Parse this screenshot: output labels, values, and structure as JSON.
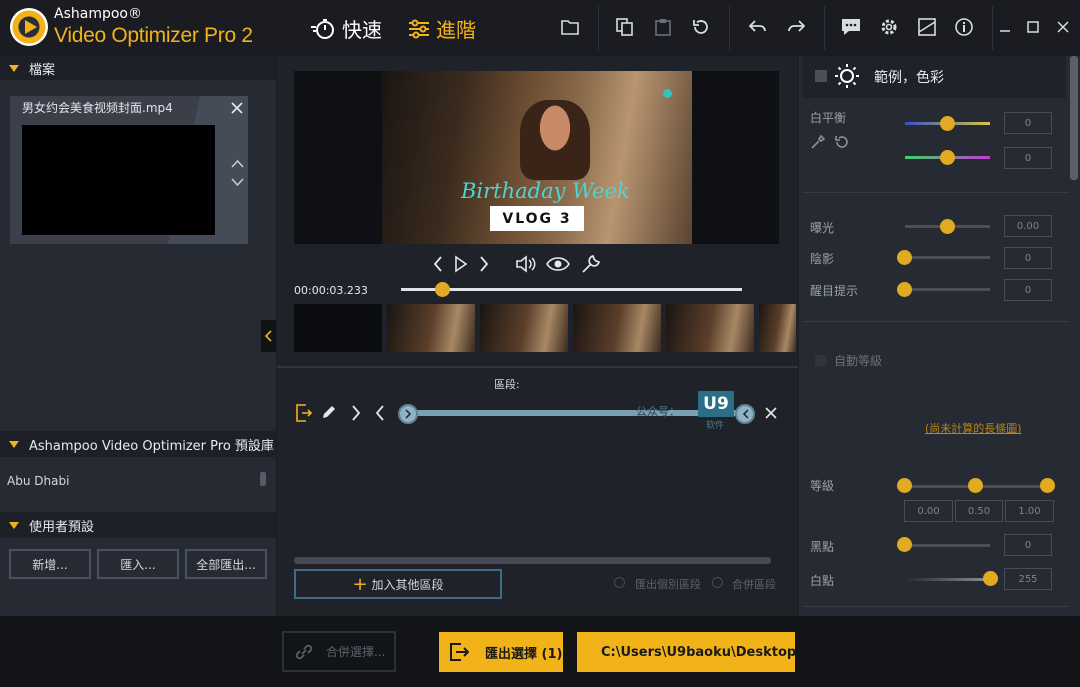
{
  "app": {
    "brand_line1": "Ashampoo®",
    "brand_line2": "Video Optimizer Pro 2",
    "mode_quick": "快速",
    "mode_advanced": "進階",
    "accent": "#f2b318"
  },
  "left": {
    "files_header": "檔案",
    "file_name": "男女约会美食视频封面.mp4",
    "presets_header": "Ashampoo Video Optimizer Pro 預設庫",
    "preset_item": "Abu Dhabi",
    "user_presets_header": "使用者預設",
    "btn_new": "新增...",
    "btn_import": "匯入...",
    "btn_export_all": "全部匯出..."
  },
  "center": {
    "overlay_script": "Birthaday Week",
    "overlay_vlog": "VLOG 3",
    "timecode": "00:00:03.233",
    "playhead_fraction": 0.12,
    "segments_label": "區段:",
    "add_segment": "加入其他區段",
    "export_individual": "匯出個別區段",
    "merge_segments": "合併區段",
    "watermark_text": "公众号：",
    "watermark_logo": "U9",
    "watermark_sub": "软件"
  },
  "right": {
    "section_title": "範例，色彩",
    "white_balance": "白平衡",
    "wb1_value": "0",
    "wb2_value": "0",
    "exposure": "曝光",
    "exposure_value": "0.00",
    "shadows": "陰影",
    "shadows_value": "0",
    "highlights": "醒目提示",
    "highlights_value": "0",
    "auto_levels": "自動等級",
    "histogram_link": "(尚未計算的長條圖)",
    "levels": "等級",
    "levels_v1": "0.00",
    "levels_v2": "0.50",
    "levels_v3": "1.00",
    "black_point": "黑點",
    "black_value": "0",
    "white_point": "白點",
    "white_value": "255"
  },
  "bottom": {
    "merge_selection": "合併選擇...",
    "export_selection": "匯出選擇 (1)",
    "output_path": "C:\\Users\\U9baoku\\Desktop"
  }
}
